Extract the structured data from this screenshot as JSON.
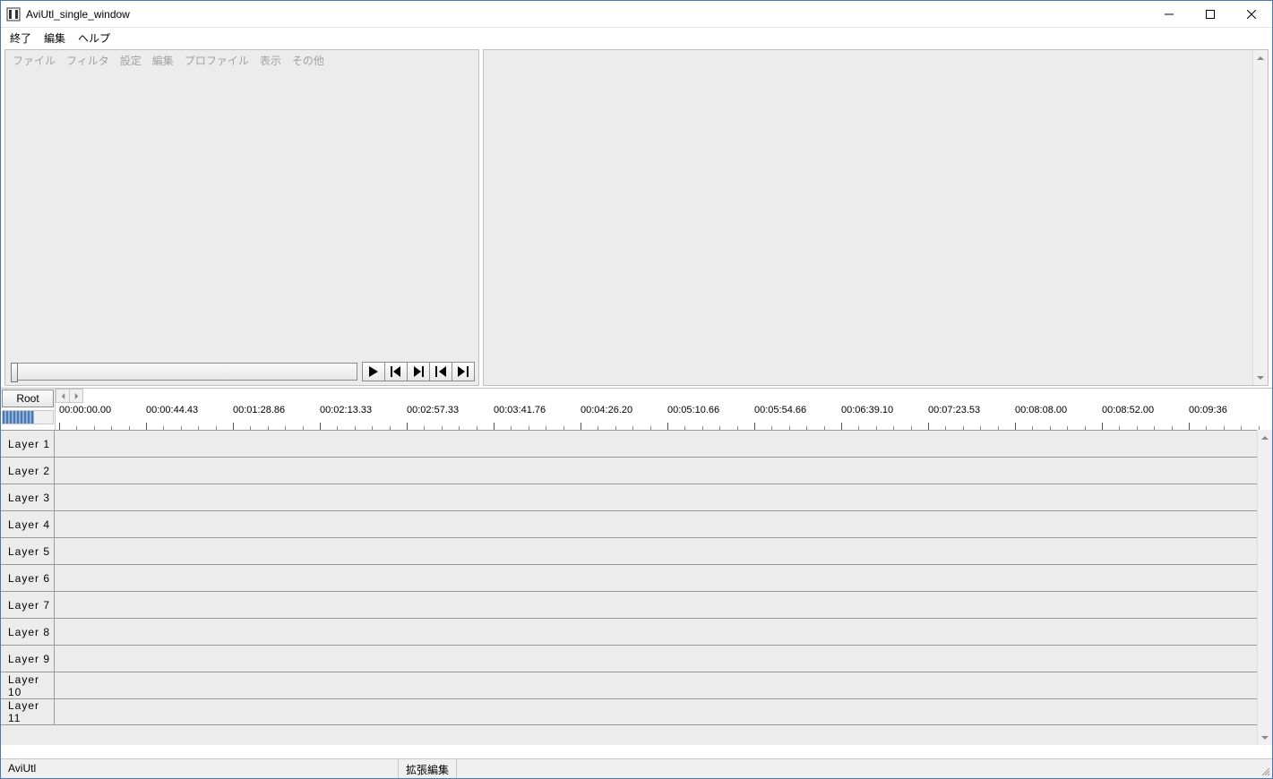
{
  "window": {
    "title": "AviUtl_single_window"
  },
  "window_menu": [
    "終了",
    "編集",
    "ヘルプ"
  ],
  "inner_menu": [
    "ファイル",
    "フィルタ",
    "設定",
    "編集",
    "プロファイル",
    "表示",
    "その他"
  ],
  "timeline": {
    "root_label": "Root",
    "times": [
      "00:00:00.00",
      "00:00:44.43",
      "00:01:28.86",
      "00:02:13.33",
      "00:02:57.33",
      "00:03:41.76",
      "00:04:26.20",
      "00:05:10.66",
      "00:05:54.66",
      "00:06:39.10",
      "00:07:23.53",
      "00:08:08.00",
      "00:08:52.00",
      "00:09:36"
    ],
    "layers": [
      "Layer 1",
      "Layer 2",
      "Layer 3",
      "Layer 4",
      "Layer 5",
      "Layer 6",
      "Layer 7",
      "Layer 8",
      "Layer 9",
      "Layer 10",
      "Layer 11"
    ]
  },
  "status": {
    "left": "AviUtl",
    "right": "拡張編集"
  }
}
